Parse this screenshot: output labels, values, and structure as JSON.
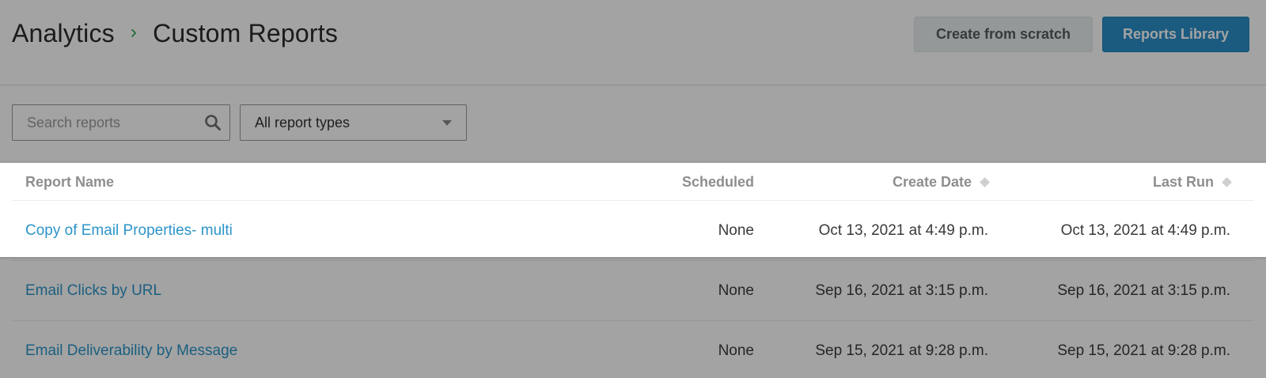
{
  "breadcrumb": {
    "root": "Analytics",
    "separator": "›",
    "current": "Custom Reports"
  },
  "actions": {
    "create_label": "Create from scratch",
    "library_label": "Reports Library"
  },
  "filters": {
    "search_placeholder": "Search reports",
    "search_value": "",
    "report_type_selected": "All report types"
  },
  "table": {
    "columns": {
      "name": "Report Name",
      "scheduled": "Scheduled",
      "create_date": "Create Date",
      "last_run": "Last Run"
    },
    "rows": [
      {
        "name": "Copy of Email Properties- multi",
        "scheduled": "None",
        "create_date": "Oct 13, 2021 at 4:49 p.m.",
        "last_run": "Oct 13, 2021 at 4:49 p.m."
      },
      {
        "name": "Email Clicks by URL",
        "scheduled": "None",
        "create_date": "Sep 16, 2021 at 3:15 p.m.",
        "last_run": "Sep 16, 2021 at 3:15 p.m."
      },
      {
        "name": "Email Deliverability by Message",
        "scheduled": "None",
        "create_date": "Sep 15, 2021 at 9:28 p.m.",
        "last_run": "Sep 15, 2021 at 9:28 p.m."
      }
    ]
  },
  "colors": {
    "accent_green": "#2fa84f",
    "primary_button": "#2b8fc9",
    "link": "#2d95c8"
  }
}
